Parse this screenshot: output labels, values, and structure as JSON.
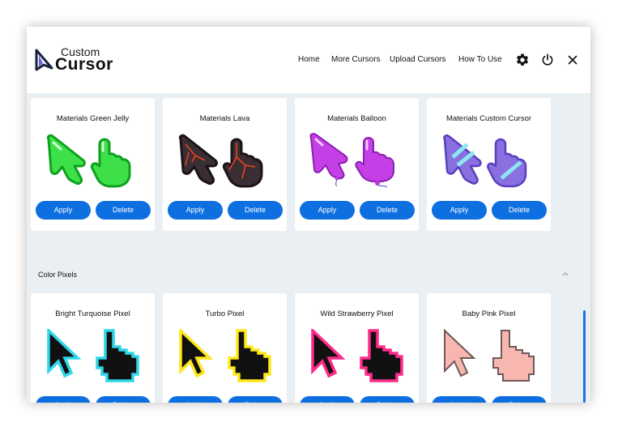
{
  "app": {
    "logo_top": "Custom",
    "logo_bottom": "Cursor"
  },
  "nav": {
    "home": "Home",
    "more_cursors": "More Cursors",
    "upload_cursors": "Upload Cursors",
    "how_to_use": "How To Use"
  },
  "header_icons": [
    "gear-icon",
    "power-icon",
    "close-icon"
  ],
  "cards": [
    {
      "title": "Materials Green Jelly",
      "apply": "Apply",
      "delete": "Delete"
    },
    {
      "title": "Materials Lava",
      "apply": "Apply",
      "delete": "Delete"
    },
    {
      "title": "Materials Balloon",
      "apply": "Apply",
      "delete": "Delete"
    },
    {
      "title": "Materials Custom Cursor",
      "apply": "Apply",
      "delete": "Delete"
    },
    {
      "title": "Bright Turquoise Pixel",
      "apply": "Apply",
      "delete": "Delete"
    },
    {
      "title": "Turbo Pixel",
      "apply": "Apply",
      "delete": "Delete"
    },
    {
      "title": "Wild Strawberry Pixel",
      "apply": "Apply",
      "delete": "Delete"
    },
    {
      "title": "Baby Pink Pixel",
      "apply": "Apply",
      "delete": "Delete"
    }
  ],
  "section": {
    "label": "Color Pixels"
  },
  "colors": {
    "accent": "#0d6fe0",
    "background": "#e9eff3",
    "green_jelly": "#3ee04a",
    "lava": "#3a2e35",
    "balloon": "#c43fe6",
    "custom": "#8a6fe0",
    "turquoise": "#2fd5e8",
    "turbo": "#ffe81a",
    "strawberry": "#ff2a8a",
    "baby_pink": "#f7b6b0"
  }
}
